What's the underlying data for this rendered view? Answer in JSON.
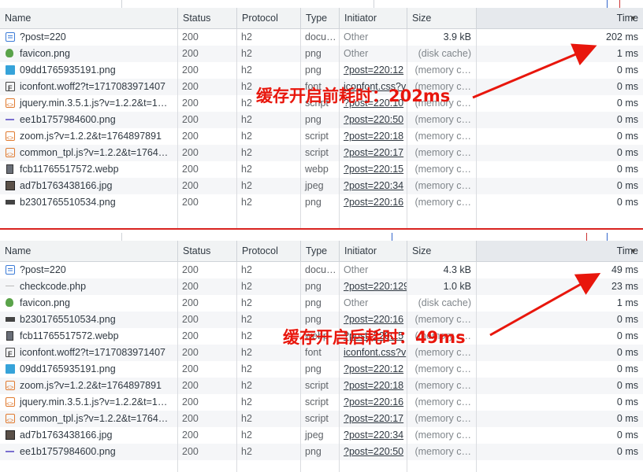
{
  "columns": [
    "Name",
    "Status",
    "Protocol",
    "Type",
    "Initiator",
    "Size",
    "Time"
  ],
  "before": {
    "annotation": "缓存开启前耗时：202ms",
    "rows": [
      {
        "icon": "document-icon",
        "name": "?post=220",
        "status": "200",
        "protocol": "h2",
        "type": "docu…",
        "initiator": "Other",
        "initiator_link": false,
        "size": "3.9 kB",
        "size_cache": false,
        "time": "202 ms"
      },
      {
        "icon": "favicon-icon",
        "name": "favicon.png",
        "status": "200",
        "protocol": "h2",
        "type": "png",
        "initiator": "Other",
        "initiator_link": false,
        "size": "(disk cache)",
        "size_cache": true,
        "time": "1 ms"
      },
      {
        "icon": "image-icon",
        "name": "09dd1765935191.png",
        "status": "200",
        "protocol": "h2",
        "type": "png",
        "initiator": "?post=220:12",
        "initiator_link": true,
        "size": "(memory c…",
        "size_cache": true,
        "time": "0 ms"
      },
      {
        "icon": "font-icon",
        "name": "iconfont.woff2?t=1717083971407",
        "status": "200",
        "protocol": "h2",
        "type": "font",
        "initiator": "iconfont.css?v",
        "initiator_link": true,
        "size": "(memory c…",
        "size_cache": true,
        "time": "0 ms"
      },
      {
        "icon": "script-icon",
        "name": "jquery.min.3.5.1.js?v=1.2.2&t=1…",
        "status": "200",
        "protocol": "h2",
        "type": "script",
        "initiator": "?post=220:10",
        "initiator_link": true,
        "size": "(memory c…",
        "size_cache": true,
        "time": "0 ms"
      },
      {
        "icon": "dash-icon",
        "name": "ee1b1757984600.png",
        "status": "200",
        "protocol": "h2",
        "type": "png",
        "initiator": "?post=220:50",
        "initiator_link": true,
        "size": "(memory c…",
        "size_cache": true,
        "time": "0 ms"
      },
      {
        "icon": "script-icon",
        "name": "zoom.js?v=1.2.2&t=1764897891",
        "status": "200",
        "protocol": "h2",
        "type": "script",
        "initiator": "?post=220:18",
        "initiator_link": true,
        "size": "(memory c…",
        "size_cache": true,
        "time": "0 ms"
      },
      {
        "icon": "script-icon",
        "name": "common_tpl.js?v=1.2.2&t=1764…",
        "status": "200",
        "protocol": "h2",
        "type": "script",
        "initiator": "?post=220:17",
        "initiator_link": true,
        "size": "(memory c…",
        "size_cache": true,
        "time": "0 ms"
      },
      {
        "icon": "photo-icon",
        "name": "fcb11765517572.webp",
        "status": "200",
        "protocol": "h2",
        "type": "webp",
        "initiator": "?post=220:15",
        "initiator_link": true,
        "size": "(memory c…",
        "size_cache": true,
        "time": "0 ms"
      },
      {
        "icon": "photo2-icon",
        "name": "ad7b1763438166.jpg",
        "status": "200",
        "protocol": "h2",
        "type": "jpeg",
        "initiator": "?post=220:34",
        "initiator_link": true,
        "size": "(memory c…",
        "size_cache": true,
        "time": "0 ms"
      },
      {
        "icon": "smallimg-icon",
        "name": "b2301765510534.png",
        "status": "200",
        "protocol": "h2",
        "type": "png",
        "initiator": "?post=220:16",
        "initiator_link": true,
        "size": "(memory c…",
        "size_cache": true,
        "time": "0 ms"
      }
    ]
  },
  "after": {
    "annotation": "缓存开启后耗时：49ms",
    "rows": [
      {
        "icon": "document-icon",
        "name": "?post=220",
        "status": "200",
        "protocol": "h2",
        "type": "docu…",
        "initiator": "Other",
        "initiator_link": false,
        "size": "4.3 kB",
        "size_cache": false,
        "time": "49 ms"
      },
      {
        "icon": "dashlight-icon",
        "name": "checkcode.php",
        "status": "200",
        "protocol": "h2",
        "type": "png",
        "initiator": "?post=220:129",
        "initiator_link": true,
        "size": "1.0 kB",
        "size_cache": false,
        "time": "23 ms"
      },
      {
        "icon": "favicon-icon",
        "name": "favicon.png",
        "status": "200",
        "protocol": "h2",
        "type": "png",
        "initiator": "Other",
        "initiator_link": false,
        "size": "(disk cache)",
        "size_cache": true,
        "time": "1 ms"
      },
      {
        "icon": "smallimg-icon",
        "name": "b2301765510534.png",
        "status": "200",
        "protocol": "h2",
        "type": "png",
        "initiator": "?post=220:16",
        "initiator_link": true,
        "size": "(memory c…",
        "size_cache": true,
        "time": "0 ms"
      },
      {
        "icon": "photo-icon",
        "name": "fcb11765517572.webp",
        "status": "200",
        "protocol": "h2",
        "type": "webp",
        "initiator": "?post=220:15",
        "initiator_link": true,
        "size": "(memory c…",
        "size_cache": true,
        "time": "0 ms"
      },
      {
        "icon": "font-icon",
        "name": "iconfont.woff2?t=1717083971407",
        "status": "200",
        "protocol": "h2",
        "type": "font",
        "initiator": "iconfont.css?v",
        "initiator_link": true,
        "size": "(memory c…",
        "size_cache": true,
        "time": "0 ms"
      },
      {
        "icon": "image-icon",
        "name": "09dd1765935191.png",
        "status": "200",
        "protocol": "h2",
        "type": "png",
        "initiator": "?post=220:12",
        "initiator_link": true,
        "size": "(memory c…",
        "size_cache": true,
        "time": "0 ms"
      },
      {
        "icon": "script-icon",
        "name": "zoom.js?v=1.2.2&t=1764897891",
        "status": "200",
        "protocol": "h2",
        "type": "script",
        "initiator": "?post=220:18",
        "initiator_link": true,
        "size": "(memory c…",
        "size_cache": true,
        "time": "0 ms"
      },
      {
        "icon": "script-icon",
        "name": "jquery.min.3.5.1.js?v=1.2.2&t=1…",
        "status": "200",
        "protocol": "h2",
        "type": "script",
        "initiator": "?post=220:16",
        "initiator_link": true,
        "size": "(memory c…",
        "size_cache": true,
        "time": "0 ms"
      },
      {
        "icon": "script-icon",
        "name": "common_tpl.js?v=1.2.2&t=1764…",
        "status": "200",
        "protocol": "h2",
        "type": "script",
        "initiator": "?post=220:17",
        "initiator_link": true,
        "size": "(memory c…",
        "size_cache": true,
        "time": "0 ms"
      },
      {
        "icon": "photo2-icon",
        "name": "ad7b1763438166.jpg",
        "status": "200",
        "protocol": "h2",
        "type": "jpeg",
        "initiator": "?post=220:34",
        "initiator_link": true,
        "size": "(memory c…",
        "size_cache": true,
        "time": "0 ms"
      },
      {
        "icon": "dash-icon",
        "name": "ee1b1757984600.png",
        "status": "200",
        "protocol": "h2",
        "type": "png",
        "initiator": "?post=220:50",
        "initiator_link": true,
        "size": "(memory c…",
        "size_cache": true,
        "time": "0 ms"
      }
    ]
  },
  "colors": {
    "annotation": "#e8160c",
    "header_bg": "#f1f3f4",
    "time_header_bg": "#e6e9ed",
    "divider": "#d9231f",
    "row_alt": "#f5f6f8"
  }
}
